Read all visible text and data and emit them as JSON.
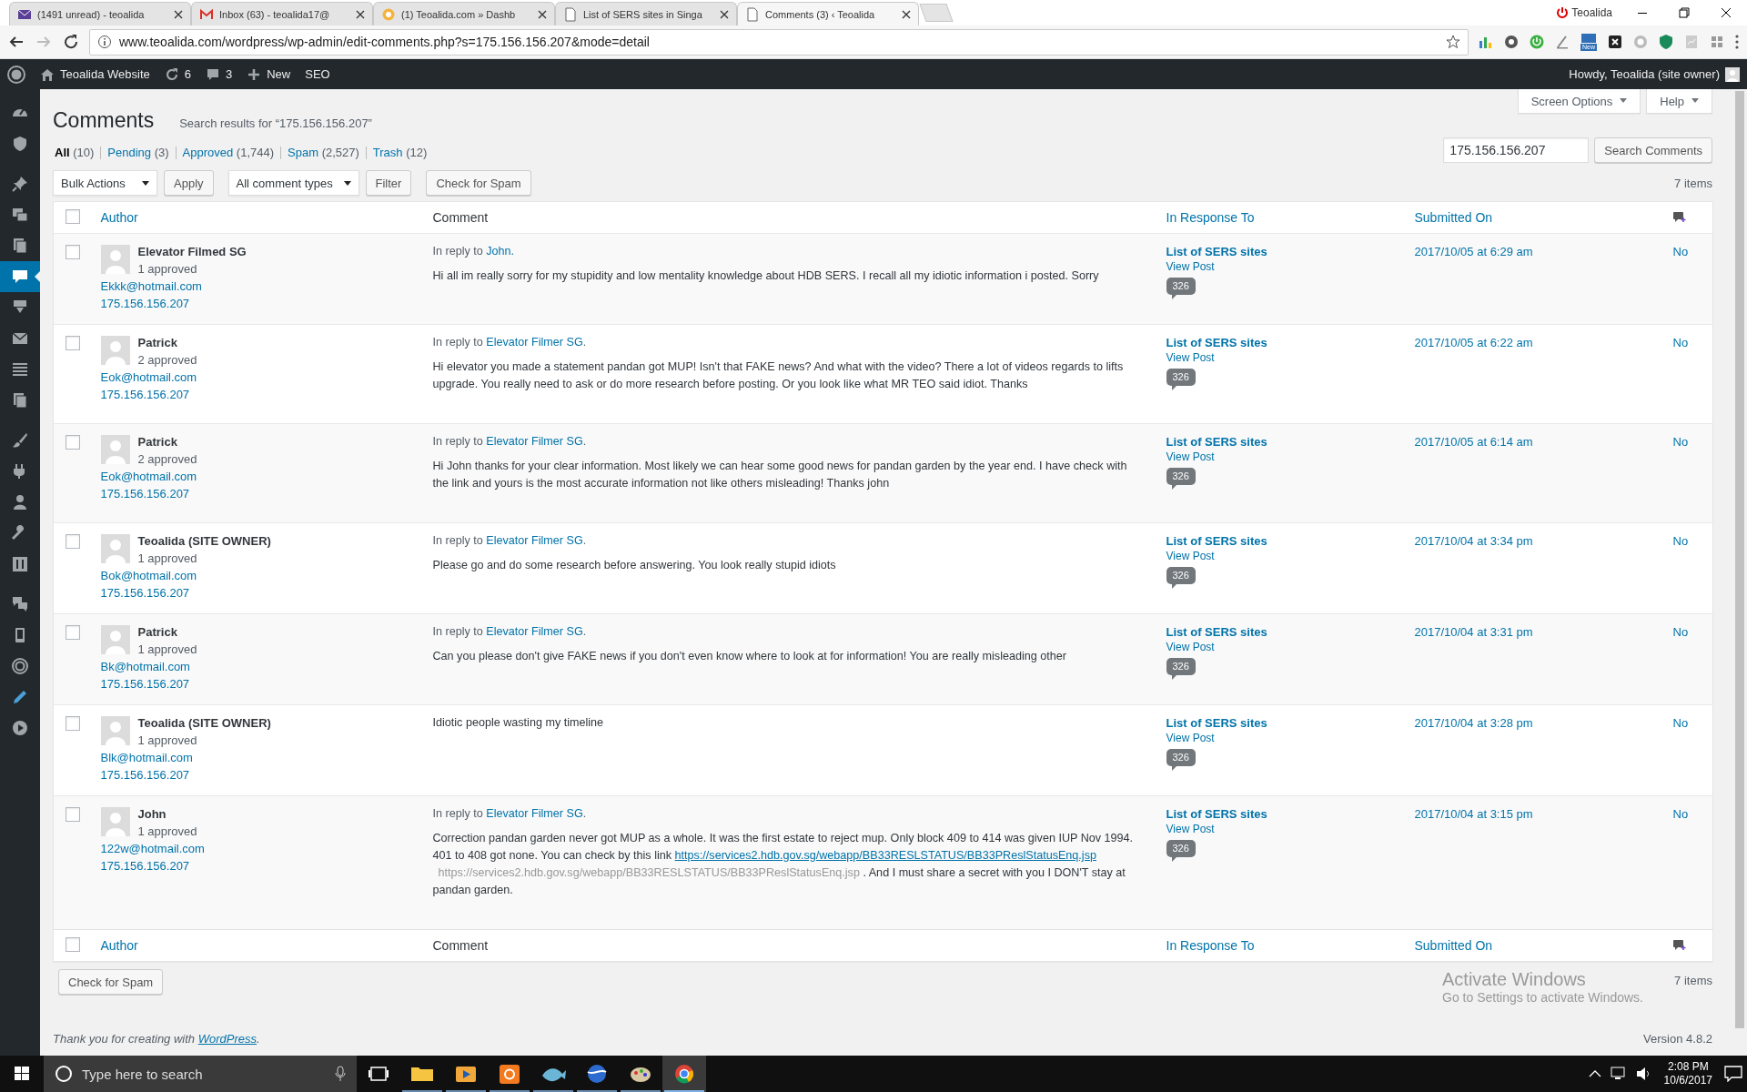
{
  "browser": {
    "tabs": [
      {
        "title": "(1491 unread) - teoalida",
        "selected": false
      },
      {
        "title": "Inbox (63) - teoalida17@",
        "selected": false
      },
      {
        "title": "(1) Teoalida.com » Dashb",
        "selected": false
      },
      {
        "title": "List of SERS sites in Singa",
        "selected": false
      },
      {
        "title": "Comments (3) ‹ Teoalida",
        "selected": true
      }
    ],
    "profile": "Teoalida",
    "url": "www.teoalida.com/wordpress/wp-admin/edit-comments.php?s=175.156.156.207&mode=detail",
    "extension_badge": "New"
  },
  "admin_bar": {
    "site": "Teoalida Website",
    "updates": "6",
    "comments": "3",
    "new": "New",
    "seo": "SEO",
    "account": "Howdy, Teoalida (site owner)"
  },
  "sidebar": {
    "groups": [
      {
        "items": [
          {
            "selected": false
          },
          {
            "selected": false
          }
        ]
      },
      {
        "items": [
          {
            "selected": false
          },
          {
            "selected": false
          },
          {
            "selected": false
          },
          {
            "selected": true
          },
          {
            "selected": false
          },
          {
            "selected": false
          },
          {
            "selected": false
          },
          {
            "selected": false
          }
        ]
      },
      {
        "items": [
          {
            "selected": false
          },
          {
            "selected": false
          },
          {
            "selected": false
          },
          {
            "selected": false
          },
          {
            "selected": false
          }
        ]
      },
      {
        "items": [
          {
            "selected": false
          },
          {
            "selected": false
          },
          {
            "selected": false
          },
          {
            "selected": false
          },
          {
            "selected": false
          }
        ]
      }
    ]
  },
  "page": {
    "title": "Comments",
    "search_note": "Search results for “175.156.156.207”",
    "screen_options": "Screen Options",
    "help": "Help",
    "views": [
      {
        "label": "All",
        "count": "(10)",
        "selected": true
      },
      {
        "label": "Pending",
        "count": "(3)",
        "selected": false
      },
      {
        "label": "Approved",
        "count": "(1,744)",
        "selected": false
      },
      {
        "label": "Spam",
        "count": "(2,527)",
        "selected": false
      },
      {
        "label": "Trash",
        "count": "(12)",
        "selected": false
      }
    ],
    "search": {
      "value": "175.156.156.207",
      "button": "Search Comments"
    },
    "bulk_actions": "Bulk Actions",
    "apply": "Apply",
    "comment_types": "All comment types",
    "filter": "Filter",
    "check_spam": "Check for Spam",
    "items_count": "7 items"
  },
  "table": {
    "select_all_checked": false,
    "footer_select_all_checked": false,
    "columns": [
      "Author",
      "Comment",
      "In Response To",
      "Submitted On"
    ],
    "rows": [
      {
        "checked": false,
        "author": "Elevator Filmed SG",
        "approved": "1 approved",
        "email": "Ekkk@hotmail.com",
        "ip": "175.156.156.207",
        "reply_prefix": "In reply to ",
        "reply_to": "John.",
        "body": [
          {
            "kind": "text",
            "text": "Hi all im really sorry for my stupidity and low mentality knowledge about HDB SERS. I recall all my idiotic information i posted. Sorry"
          }
        ],
        "post": "List of SERS sites",
        "view_post": "View Post",
        "comments": "326",
        "submitted": "2017/10/05 at 6:29 am",
        "status": "No"
      },
      {
        "checked": false,
        "author": "Patrick",
        "approved": "2 approved",
        "email": "Eok@hotmail.com",
        "ip": "175.156.156.207",
        "reply_prefix": "In reply to ",
        "reply_to": "Elevator Filmer SG",
        "reply_suffix": ".",
        "body": [
          {
            "kind": "text",
            "text": "Hi elevator you made a statement pandan got MUP! Isn't that FAKE news? And what with the video? There a lot of videos regards to lifts upgrade. You really need to ask or do more research before posting. Or you look like what MR TEO said idiot. Thanks"
          }
        ],
        "post": "List of SERS sites",
        "view_post": "View Post",
        "comments": "326",
        "submitted": "2017/10/05 at 6:22 am",
        "status": "No"
      },
      {
        "checked": false,
        "author": "Patrick",
        "approved": "2 approved",
        "email": "Eok@hotmail.com",
        "ip": "175.156.156.207",
        "reply_prefix": "In reply to ",
        "reply_to": "Elevator Filmer SG",
        "reply_suffix": ".",
        "body": [
          {
            "kind": "text",
            "text": "Hi John thanks for your clear information. Most likely we can hear some good news for pandan garden by the year end. I have check with the link and yours is the most accurate information not like others misleading! Thanks john"
          }
        ],
        "post": "List of SERS sites",
        "view_post": "View Post",
        "comments": "326",
        "submitted": "2017/10/05 at 6:14 am",
        "status": "No"
      },
      {
        "checked": false,
        "author": "Teoalida (SITE OWNER)",
        "approved": "1 approved",
        "email": "Bok@hotmail.com",
        "ip": "175.156.156.207",
        "reply_prefix": "In reply to ",
        "reply_to": "Elevator Filmer SG",
        "reply_suffix": ".",
        "body": [
          {
            "kind": "text",
            "text": "Please go and do some research before answering. You look really stupid idiots"
          }
        ],
        "post": "List of SERS sites",
        "view_post": "View Post",
        "comments": "326",
        "submitted": "2017/10/04 at 3:34 pm",
        "status": "No"
      },
      {
        "checked": false,
        "author": "Patrick",
        "approved": "1 approved",
        "email": "Bk@hotmail.com",
        "ip": "175.156.156.207",
        "reply_prefix": "In reply to ",
        "reply_to": "Elevator Filmer SG",
        "reply_suffix": ".",
        "body": [
          {
            "kind": "text",
            "text": "Can you please don't give FAKE news if you don't even know where to look at for information! You are really misleading other"
          }
        ],
        "post": "List of SERS sites",
        "view_post": "View Post",
        "comments": "326",
        "submitted": "2017/10/04 at 3:31 pm",
        "status": "No"
      },
      {
        "checked": false,
        "author": "Teoalida (SITE OWNER)",
        "approved": "1 approved",
        "email": "Blk@hotmail.com",
        "ip": "175.156.156.207",
        "body": [
          {
            "kind": "text",
            "text": "Idiotic people wasting my timeline"
          }
        ],
        "post": "List of SERS sites",
        "view_post": "View Post",
        "comments": "326",
        "submitted": "2017/10/04 at 3:28 pm",
        "status": "No"
      },
      {
        "checked": false,
        "author": "John",
        "approved": "1 approved",
        "email": "122w@hotmail.com",
        "ip": "175.156.156.207",
        "reply_prefix": "In reply to ",
        "reply_to": "Elevator Filmer SG",
        "reply_suffix": ".",
        "body": [
          {
            "kind": "text",
            "text": "Correction pandan garden never got MUP as a whole. It was the first estate to reject mup. Only block 409 to 414 was given IUP Nov 1994. 401 to 408 got none. You can check by this link "
          },
          {
            "kind": "link",
            "text": "https://services2.hdb.gov.sg/webapp/BB33RESLSTATUS/BB33PReslStatusEnq.jsp"
          },
          {
            "kind": "muted",
            "text": "https://services2.hdb.gov.sg/webapp/BB33RESLSTATUS/BB33PReslStatusEnq.jsp"
          },
          {
            "kind": "text",
            "text": " . And I must share a secret with you I DON'T stay at pandan garden."
          }
        ],
        "post": "List of SERS sites",
        "view_post": "View Post",
        "comments": "326",
        "submitted": "2017/10/04 at 3:15 pm",
        "status": "No"
      }
    ],
    "footer_columns": [
      "Author",
      "Comment",
      "In Response To",
      "Submitted On"
    ]
  },
  "footer": {
    "check_spam": "Check for Spam",
    "items_count": "7 items",
    "thanks_prefix": "Thank you for creating with ",
    "thanks_link": "WordPress",
    "thanks_suffix": ".",
    "version": "Version 4.8.2"
  },
  "activation": {
    "title": "Activate Windows",
    "note": "Go to Settings to activate Windows."
  },
  "taskbar": {
    "search_placeholder": "Type here to search",
    "apps": [
      {
        "selected": false
      },
      {
        "selected": false
      },
      {
        "selected": false
      },
      {
        "selected": false
      },
      {
        "selected": false
      },
      {
        "selected": false
      },
      {
        "selected": true
      }
    ],
    "time": "2:08 PM",
    "date": "10/6/2017"
  }
}
